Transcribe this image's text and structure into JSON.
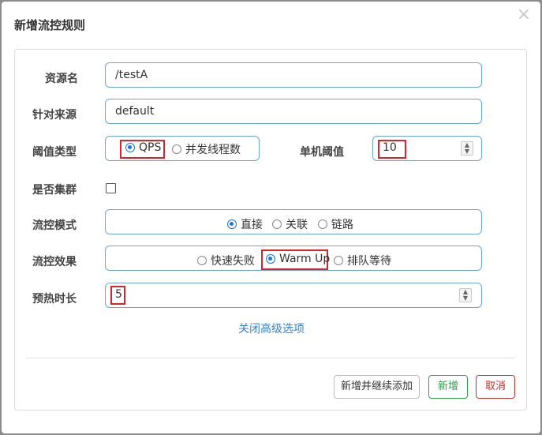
{
  "dialog": {
    "title": "新增流控规则",
    "close_glyph": "×"
  },
  "form": {
    "resource": {
      "label": "资源名",
      "value": "/testA"
    },
    "source": {
      "label": "针对来源",
      "value": "default"
    },
    "threshold_type": {
      "label": "阈值类型",
      "options": [
        {
          "label": "QPS",
          "selected": true
        },
        {
          "label": "并发线程数",
          "selected": false
        }
      ]
    },
    "single_threshold": {
      "label": "单机阈值",
      "value": "10"
    },
    "cluster": {
      "label": "是否集群",
      "checked": false
    },
    "flow_mode": {
      "label": "流控模式",
      "options": [
        {
          "label": "直接",
          "selected": true
        },
        {
          "label": "关联",
          "selected": false
        },
        {
          "label": "链路",
          "selected": false
        }
      ]
    },
    "flow_effect": {
      "label": "流控效果",
      "options": [
        {
          "label": "快速失败",
          "selected": false
        },
        {
          "label": "Warm Up",
          "selected": true
        },
        {
          "label": "排队等待",
          "selected": false
        }
      ]
    },
    "warmup": {
      "label": "预热时长",
      "value": "5"
    },
    "advanced_link": "关闭高级选项"
  },
  "buttons": {
    "add_continue": "新增并继续添加",
    "add": "新增",
    "cancel": "取消"
  },
  "colors": {
    "add_button": "#2f9e4a",
    "cancel_button": "#c9302c",
    "highlight_box": "#d9232d",
    "radio_selected": "#1a73e8",
    "link": "#3a80c4"
  }
}
